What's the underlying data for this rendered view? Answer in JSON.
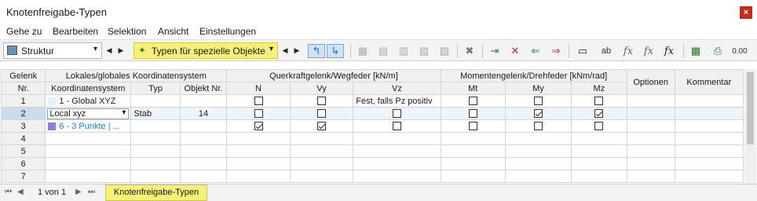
{
  "window": {
    "title": "Knotenfreigabe-Typen",
    "close_glyph": "×"
  },
  "menu": [
    "Gehe zu",
    "Bearbeiten",
    "Selektion",
    "Ansicht",
    "Einstellungen"
  ],
  "toolbar": {
    "structure_combo": "Struktur",
    "filter_combo": "Typen für spezielle Objekte",
    "accent_color": "#f5f07a"
  },
  "table": {
    "headers": {
      "gelenk": "Gelenk",
      "nr": "Nr.",
      "group_lokal": "Lokales/globales Koordinatensystem",
      "koord": "Koordinatensystem",
      "typ": "Typ",
      "objekt": "Objekt Nr.",
      "group_quer": "Querkraftgelenk/Wegfeder [kN/m]",
      "n": "N",
      "vy": "Vy",
      "vz": "Vz",
      "group_moment": "Momentengelenk/Drehfeder [kNm/rad]",
      "mt": "Mt",
      "my": "My",
      "mz": "Mz",
      "optionen": "Optionen",
      "kommentar": "Kommentar"
    },
    "rows": [
      {
        "nr": "1",
        "koord": "1 - Global XYZ",
        "typ": "",
        "objekt": "",
        "n": false,
        "vy": false,
        "vz_text": "Fest, falls Pz positiv",
        "mt": false,
        "my": false,
        "mz": false
      },
      {
        "nr": "2",
        "koord": "Local xyz",
        "typ": "Stab",
        "objekt": "14",
        "n": false,
        "vy": false,
        "vz": false,
        "mt": false,
        "my": true,
        "mz": true
      },
      {
        "nr": "3",
        "koord": "6 - 3 Punkte | ...",
        "typ": "",
        "objekt": "",
        "n": true,
        "vy": true,
        "vz": false,
        "mt": false,
        "my": false,
        "mz": false
      },
      {
        "nr": "4"
      },
      {
        "nr": "5"
      },
      {
        "nr": "6"
      },
      {
        "nr": "7"
      }
    ]
  },
  "status": {
    "page_info": "1 von 1",
    "sheet_tab": "Knotenfreigabe-Typen"
  }
}
